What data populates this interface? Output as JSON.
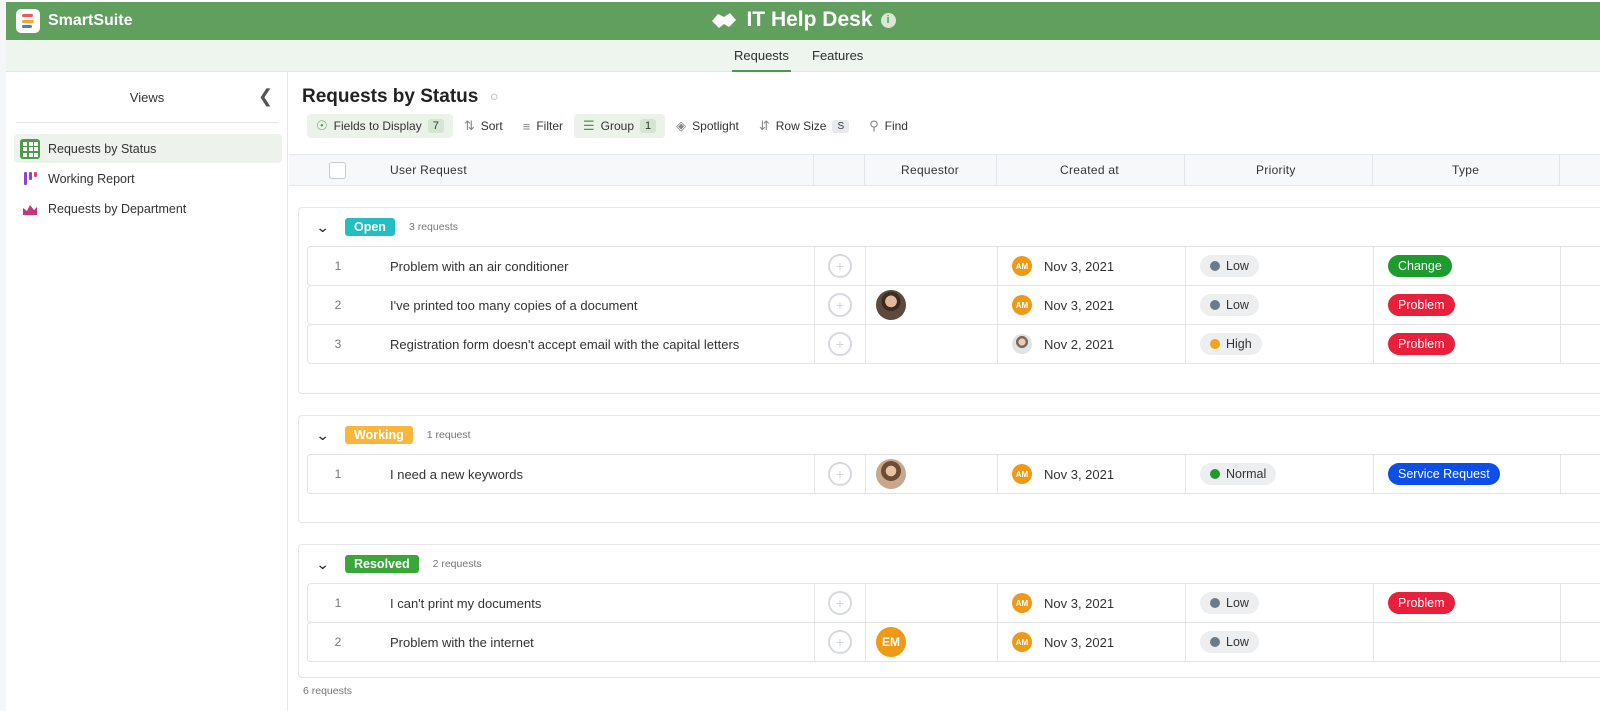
{
  "brand": {
    "name": "SmartSuite"
  },
  "app": {
    "title": "IT Help Desk",
    "info_icon": "i"
  },
  "tabs": [
    {
      "label": "Requests",
      "active": true
    },
    {
      "label": "Features",
      "active": false
    }
  ],
  "sidebar": {
    "title": "Views",
    "items": [
      {
        "label": "Requests by Status",
        "icon": "grid-icon",
        "active": true
      },
      {
        "label": "Working Report",
        "icon": "kanban-icon",
        "active": false
      },
      {
        "label": "Requests by Department",
        "icon": "chart-icon",
        "active": false
      }
    ]
  },
  "view": {
    "title": "Requests by Status",
    "toolbar": {
      "fields": "Fields to Display",
      "fields_count": "7",
      "sort": "Sort",
      "filter": "Filter",
      "group": "Group",
      "group_count": "1",
      "spotlight": "Spotlight",
      "row_size": "Row Size",
      "row_size_value": "S",
      "find": "Find"
    }
  },
  "columns": {
    "user_request": "User Request",
    "requestor": "Requestor",
    "created_at": "Created at",
    "priority": "Priority",
    "type": "Type"
  },
  "groups": [
    {
      "status": "Open",
      "color": "#21bfc1",
      "count_label": "3 requests",
      "rows": [
        {
          "num": "1",
          "request": "Problem with an air conditioner",
          "requestor": "",
          "created_by": "AM",
          "created": "Nov 3, 2021",
          "priority": "Low",
          "priority_color": "#6c7b8b",
          "type": "Change",
          "type_color": "#1e9b2d"
        },
        {
          "num": "2",
          "request": "I've printed too many copies of a document",
          "requestor": "photo",
          "created_by": "AM",
          "created": "Nov 3, 2021",
          "priority": "Low",
          "priority_color": "#6c7b8b",
          "type": "Problem",
          "type_color": "#e8203c"
        },
        {
          "num": "3",
          "request": "Registration form doesn't accept email with the capital letters",
          "requestor": "",
          "created_by": "photo",
          "created": "Nov 2, 2021",
          "priority": "High",
          "priority_color": "#f5a313",
          "type": "Problem",
          "type_color": "#e8203c"
        }
      ]
    },
    {
      "status": "Working",
      "color": "#f8b73b",
      "count_label": "1 request",
      "rows": [
        {
          "num": "1",
          "request": "I need a new keywords",
          "requestor": "photo2",
          "created_by": "AM",
          "created": "Nov 3, 2021",
          "priority": "Normal",
          "priority_color": "#1f9b2a",
          "type": "Service Request",
          "type_color": "#0d4fe6"
        }
      ]
    },
    {
      "status": "Resolved",
      "color": "#3ba63a",
      "count_label": "2 requests",
      "rows": [
        {
          "num": "1",
          "request": "I can't print my documents",
          "requestor": "",
          "created_by": "AM",
          "created": "Nov 3, 2021",
          "priority": "Low",
          "priority_color": "#6c7b8b",
          "type": "Problem",
          "type_color": "#e8203c"
        },
        {
          "num": "2",
          "request": "Problem with the internet",
          "requestor": "EM",
          "created_by": "AM",
          "created": "Nov 3, 2021",
          "priority": "Low",
          "priority_color": "#6c7b8b",
          "type": "",
          "type_color": ""
        }
      ]
    }
  ],
  "footer": {
    "total": "6 requests"
  }
}
